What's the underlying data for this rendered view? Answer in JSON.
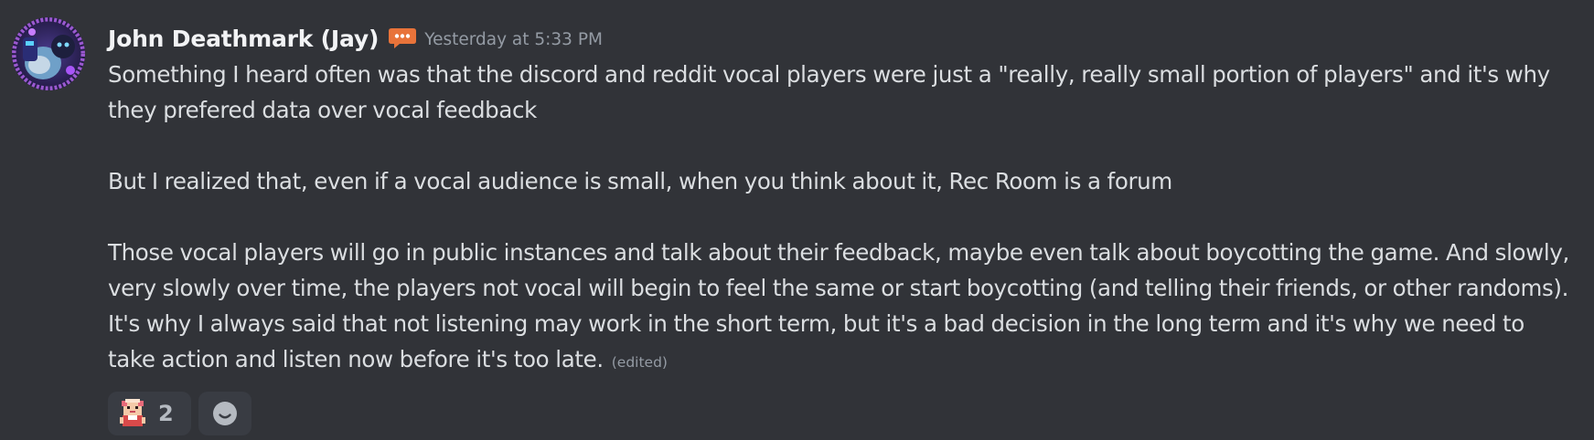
{
  "message": {
    "author": "John Deathmark (Jay)",
    "role_icon": "speech-bubble-icon",
    "timestamp": "Yesterday at 5:33 PM",
    "paragraphs": [
      "Something I heard often was that the discord and reddit vocal players were just a \"really, really small portion of players\" and it's why they prefered data over vocal feedback",
      "But I realized that, even if a vocal audience is small, when you think about it, Rec Room is a forum",
      "Those vocal players will go in public instances and talk about their feedback, maybe even talk about boycotting the game. And slowly, very slowly over time, the players not vocal will begin to feel the same or start boycotting (and telling their friends, or other randoms). It's why I always said that not listening may work in the short term, but it's a bad decision in the long term and it's why we need to take action and listen now before it's too late."
    ],
    "edited_label": "(edited)",
    "reactions": [
      {
        "emoji": "pixel-character-emoji",
        "count": "2"
      }
    ],
    "add_reaction_icon": "smiley-add-reaction-icon"
  },
  "colors": {
    "background": "#313338",
    "username": "#f2f3f5",
    "body_text": "#dbdee1",
    "muted": "#949ba4",
    "reaction_bg": "#393c43",
    "role_icon": "#e8733a"
  }
}
